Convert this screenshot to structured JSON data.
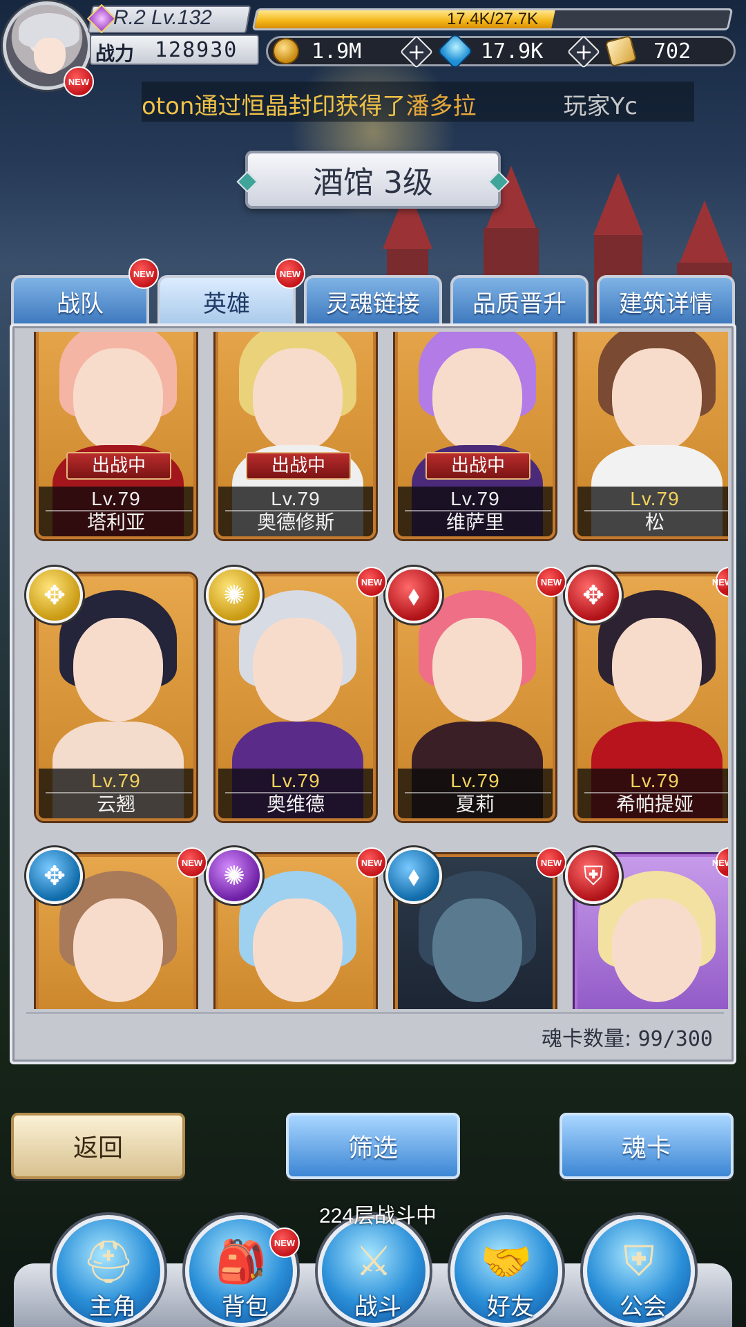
{
  "player": {
    "rank_level": "R.2 Lv.132",
    "exp_text": "17.4K/27.7K",
    "exp_fraction": 0.628,
    "power_label": "战力",
    "power_value": "128930",
    "avatar_new": "NEW"
  },
  "resources": {
    "gold": "1.9M",
    "gems": "17.9K",
    "tickets": "702",
    "plus_glyph": "+"
  },
  "ticker": {
    "part1": "oton通过恒晶封印获得了",
    "part2": "潘多拉",
    "part3": "玩家Yc"
  },
  "title": "酒馆 3级",
  "tabs": [
    {
      "label": "战队",
      "badge": "NEW"
    },
    {
      "label": "英雄",
      "badge": "NEW",
      "active": true
    },
    {
      "label": "灵魂链接"
    },
    {
      "label": "品质晋升"
    },
    {
      "label": "建筑详情"
    }
  ],
  "cards": [
    {
      "name": "塔利亚",
      "level": "Lv.79",
      "status": "出战中"
    },
    {
      "name": "奥德修斯",
      "level": "Lv.79",
      "status": "出战中"
    },
    {
      "name": "维萨里",
      "level": "Lv.79",
      "status": "出战中"
    },
    {
      "name": "松",
      "level": "Lv.79"
    },
    {
      "name": "云翘",
      "level": "Lv.79"
    },
    {
      "name": "奥维德",
      "level": "Lv.79",
      "badge": "NEW"
    },
    {
      "name": "夏莉",
      "level": "Lv.79",
      "badge": "NEW"
    },
    {
      "name": "希帕提娅",
      "level": "Lv.79",
      "badge": "NEW"
    },
    {
      "badge": "NEW"
    },
    {
      "badge": "NEW"
    },
    {
      "badge": "NEW"
    },
    {
      "badge": "NEW"
    }
  ],
  "count": {
    "label": "魂卡数量:",
    "value": "99/300"
  },
  "buttons": {
    "back": "返回",
    "filter": "筛选",
    "soulcard": "魂卡"
  },
  "battle_status": {
    "floor": "224",
    "text": "层战斗中"
  },
  "nav": [
    {
      "label": "主角"
    },
    {
      "label": "背包",
      "badge": "NEW"
    },
    {
      "label": "战斗"
    },
    {
      "label": "好友"
    },
    {
      "label": "公会"
    }
  ],
  "colors": {
    "exp_gold": "#f3b617",
    "tab_blue": "#3d78bd",
    "card_gold": "#c98328",
    "new_red": "#c4141a"
  }
}
